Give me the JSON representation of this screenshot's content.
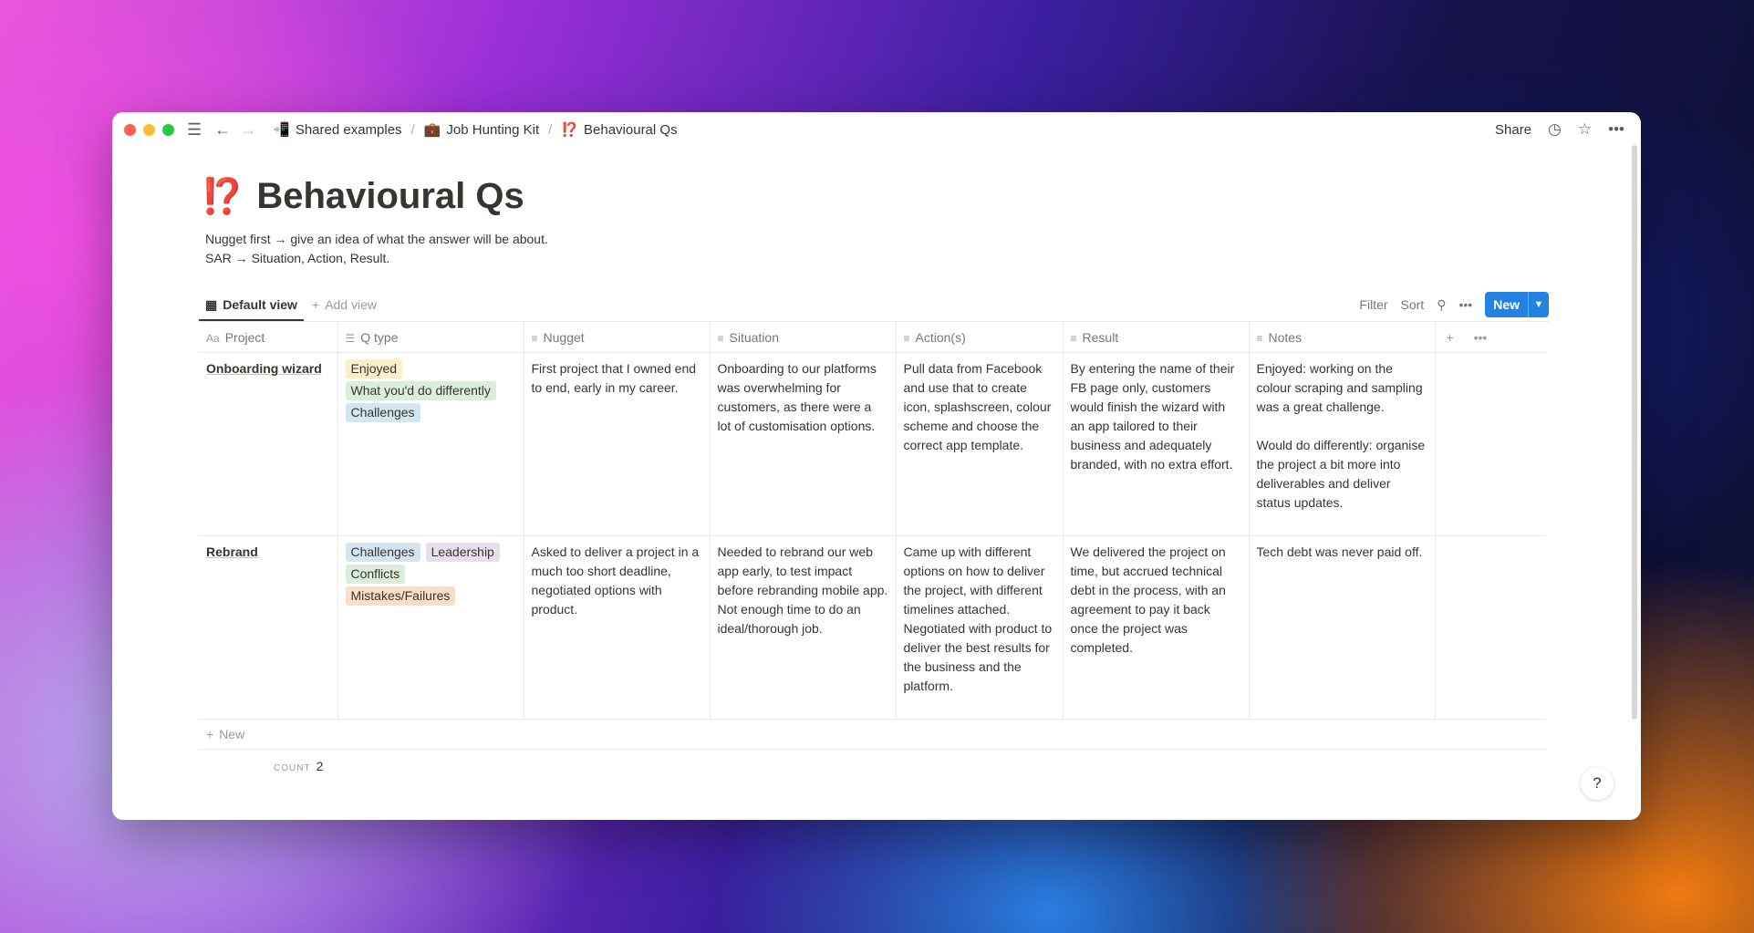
{
  "breadcrumbs": [
    {
      "icon": "📲",
      "label": "Shared examples"
    },
    {
      "icon": "💼",
      "label": "Job Hunting Kit"
    },
    {
      "icon": "⁉️",
      "label": "Behavioural Qs"
    }
  ],
  "topbar": {
    "share_label": "Share"
  },
  "page": {
    "icon": "⁉️",
    "title": "Behavioural Qs",
    "description": [
      "Nugget first → give an idea of what the answer will be about.",
      "SAR → Situation, Action, Result."
    ]
  },
  "views": {
    "active": "Default view",
    "add_label": "Add view",
    "filter_label": "Filter",
    "sort_label": "Sort",
    "new_label": "New"
  },
  "table": {
    "columns": [
      "Project",
      "Q type",
      "Nugget",
      "Situation",
      "Action(s)",
      "Result",
      "Notes"
    ],
    "rows": [
      {
        "project": "Onboarding wizard",
        "q_types": [
          {
            "label": "Enjoyed",
            "bg": "#fbeecc"
          },
          {
            "label": "What you'd do differently",
            "bg": "#dbeddb"
          },
          {
            "label": "Challenges",
            "bg": "#d3e5ef"
          }
        ],
        "nugget": "First project that I owned end to end, early in my career.",
        "situation": "Onboarding to our platforms was overwhelming for customers, as there were a lot of customisation options.",
        "actions": "Pull data from Facebook and use that to create icon, splashscreen, colour scheme and choose the correct app template.",
        "result": "By entering the name of their FB page only, customers would finish the wizard with an app tailored to their business and adequately branded, with no extra effort.",
        "notes": "Enjoyed: working on the colour scraping and sampling was a great challenge.\n\nWould do differently: organise the project a bit more into deliverables and deliver status updates."
      },
      {
        "project": "Rebrand",
        "q_types": [
          {
            "label": "Challenges",
            "bg": "#d3e5ef"
          },
          {
            "label": "Leadership",
            "bg": "#e8deee"
          },
          {
            "label": "Conflicts",
            "bg": "#dbeddb"
          },
          {
            "label": "Mistakes/Failures",
            "bg": "#fadec9"
          }
        ],
        "nugget": "Asked to deliver a project in a much too short deadline, negotiated options with product.",
        "situation": "Needed to rebrand our web app early, to test impact before rebranding mobile app. Not enough time to do an ideal/thorough job.",
        "actions": "Came up with different options on how to deliver the project, with different timelines attached. Negotiated with product to deliver the best results for the business and the platform.",
        "result": "We delivered the project on time, but accrued technical debt in the process, with an agreement to pay it back once the project was completed.",
        "notes": "Tech debt was never paid off."
      }
    ],
    "new_row_label": "New",
    "count_label": "COUNT",
    "count_value": "2"
  },
  "help_label": "?"
}
